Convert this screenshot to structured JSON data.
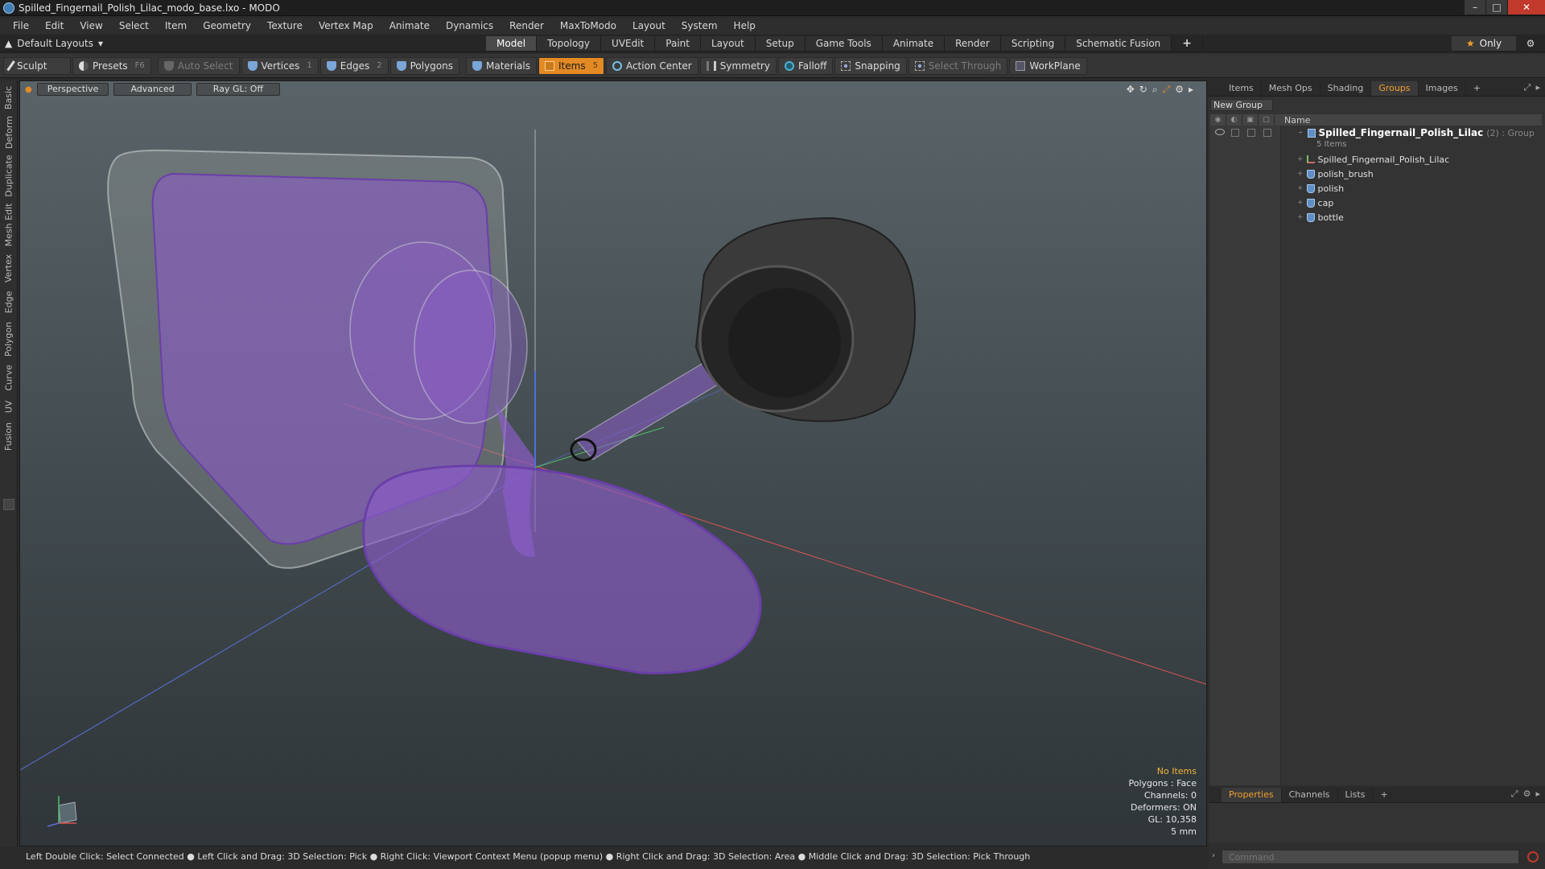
{
  "window": {
    "title": "Spilled_Fingernail_Polish_Lilac_modo_base.lxo - MODO",
    "controls": [
      "–",
      "□",
      "✕"
    ]
  },
  "menu": [
    "File",
    "Edit",
    "View",
    "Select",
    "Item",
    "Geometry",
    "Texture",
    "Vertex Map",
    "Animate",
    "Dynamics",
    "Render",
    "MaxToModo",
    "Layout",
    "System",
    "Help"
  ],
  "layout_bar": {
    "layout_name": "Default Layouts",
    "tabs": [
      "Model",
      "Topology",
      "UVEdit",
      "Paint",
      "Layout",
      "Setup",
      "Game Tools",
      "Animate",
      "Render",
      "Scripting",
      "Schematic Fusion"
    ],
    "active_tab": "Model",
    "plus": "+",
    "only_label": "Only"
  },
  "toolbar": {
    "sculpt": "Sculpt",
    "presets": "Presets",
    "presets_key": "F6",
    "auto_select": "Auto Select",
    "vertices": "Vertices",
    "vertices_count": "1",
    "edges": "Edges",
    "edges_count": "2",
    "polygons": "Polygons",
    "materials": "Materials",
    "items": "Items",
    "items_count": "5",
    "action_center": "Action Center",
    "symmetry": "Symmetry",
    "falloff": "Falloff",
    "snapping": "Snapping",
    "select_through": "Select Through",
    "workplane": "WorkPlane"
  },
  "left_tabs": [
    "Basic",
    "Deform",
    "Duplicate",
    "Mesh Edit",
    "Vertex",
    "Edge",
    "Polygon",
    "Curve",
    "UV",
    "Fusion"
  ],
  "viewport": {
    "view": "Perspective",
    "shading": "Advanced",
    "raygl": "Ray GL: Off",
    "info": {
      "no_items": "No Items",
      "polygons": "Polygons : Face",
      "channels": "Channels: 0",
      "deformers": "Deformers: ON",
      "gl": "GL: 10,358",
      "scale": "5 mm"
    },
    "colors": {
      "polish": "#8a5cc8",
      "polish_edge": "#6a3fa8",
      "bottle": "#9aa0a0",
      "cap": "#2a2a2a"
    }
  },
  "status": "Left Double Click: Select Connected ● Left Click and Drag: 3D Selection: Pick ● Right Click: Viewport Context Menu (popup menu) ● Right Click and Drag: 3D Selection: Area ● Middle Click and Drag: 3D Selection: Pick Through",
  "right_panel": {
    "top_tabs": [
      "Items",
      "Mesh Ops",
      "Shading",
      "Groups",
      "Images"
    ],
    "active_top_tab": "Groups",
    "new_group": "New Group",
    "name_header": "Name",
    "group": {
      "name": "Spilled_Fingernail_Polish_Lilac",
      "meta": "(2) : Group",
      "count": "5 Items"
    },
    "items": [
      {
        "name": "Spilled_Fingernail_Polish_Lilac",
        "kind": "locator"
      },
      {
        "name": "polish_brush",
        "kind": "mesh"
      },
      {
        "name": "polish",
        "kind": "mesh"
      },
      {
        "name": "cap",
        "kind": "mesh"
      },
      {
        "name": "bottle",
        "kind": "mesh"
      }
    ],
    "bottom_tabs": [
      "Properties",
      "Channels",
      "Lists"
    ],
    "active_bottom_tab": "Properties",
    "command_placeholder": "Command"
  }
}
